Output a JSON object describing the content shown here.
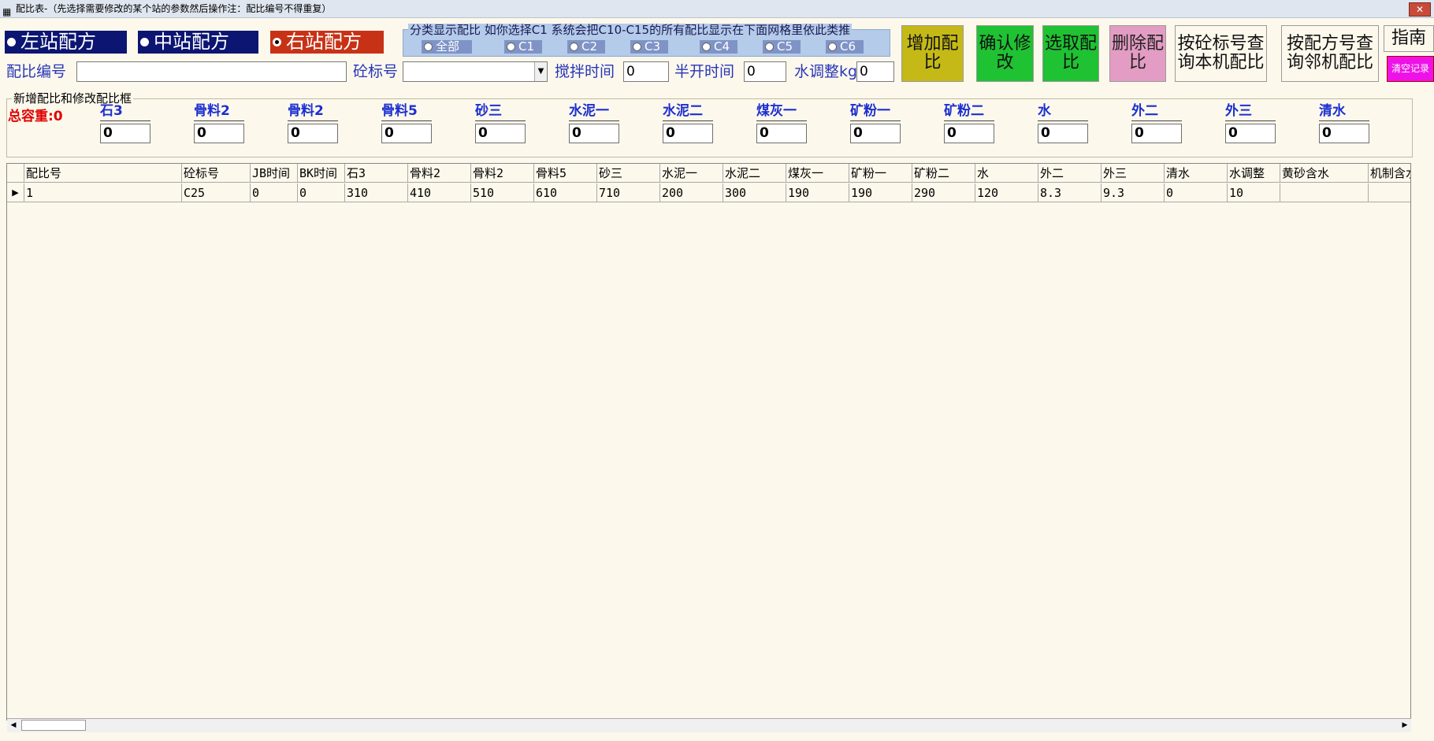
{
  "window": {
    "title": "配比表-（先选择需要修改的某个站的参数然后操作注：配比编号不得重复）",
    "close_label": "✕"
  },
  "stations": [
    {
      "label": "左站配方",
      "checked": false
    },
    {
      "label": "中站配方",
      "checked": false
    },
    {
      "label": "右站配方",
      "checked": true
    }
  ],
  "filter": {
    "legend": "分类显示配比 如你选择C1 系统会把C10-C15的所有配比显示在下面网格里依此类推",
    "options": [
      "全部",
      "C1",
      "C2",
      "C3",
      "C4",
      "C5",
      "C6"
    ]
  },
  "buttons": {
    "add": "增加配比",
    "confirm": "确认修改",
    "select": "选取配比",
    "delete": "删除配比",
    "query_local": "按砼标号查询本机配比",
    "query_neighbor": "按配方号查询邻机配比",
    "guide": "指南",
    "clear": "清空记录"
  },
  "form": {
    "mix_no_label": "配比编号",
    "mix_no_value": "",
    "grade_label": "砼标号",
    "grade_value": "",
    "mix_time_label": "搅拌时间",
    "mix_time_value": "0",
    "half_open_label": "半开时间",
    "half_open_value": "0",
    "water_adj_label": "水调整kg",
    "water_adj_value": "0"
  },
  "edit_box": {
    "legend": "新增配比和修改配比框",
    "total_weight": "总容重:0",
    "materials": [
      {
        "label": "石3",
        "value": "0"
      },
      {
        "label": "骨料2",
        "value": "0"
      },
      {
        "label": "骨料2",
        "value": "0"
      },
      {
        "label": "骨料5",
        "value": "0"
      },
      {
        "label": "砂三",
        "value": "0"
      },
      {
        "label": "水泥一",
        "value": "0"
      },
      {
        "label": "水泥二",
        "value": "0"
      },
      {
        "label": "煤灰一",
        "value": "0"
      },
      {
        "label": "矿粉一",
        "value": "0"
      },
      {
        "label": "矿粉二",
        "value": "0"
      },
      {
        "label": "水",
        "value": "0"
      },
      {
        "label": "外二",
        "value": "0"
      },
      {
        "label": "外三",
        "value": "0"
      },
      {
        "label": "清水",
        "value": "0"
      }
    ]
  },
  "grid": {
    "columns": [
      "配比号",
      "砼标号",
      "JB时间",
      "BK时间",
      "石3",
      "骨料2",
      "骨料2",
      "骨料5",
      "砂三",
      "水泥一",
      "水泥二",
      "煤灰一",
      "矿粉一",
      "矿粉二",
      "水",
      "外二",
      "外三",
      "清水",
      "水调整",
      "黄砂含水",
      "机制含水"
    ],
    "rows": [
      [
        "1",
        "C25",
        "0",
        "0",
        "310",
        "410",
        "510",
        "610",
        "710",
        "200",
        "300",
        "190",
        "190",
        "290",
        "120",
        "8.3",
        "9.3",
        "0",
        "10",
        "",
        ""
      ]
    ]
  }
}
